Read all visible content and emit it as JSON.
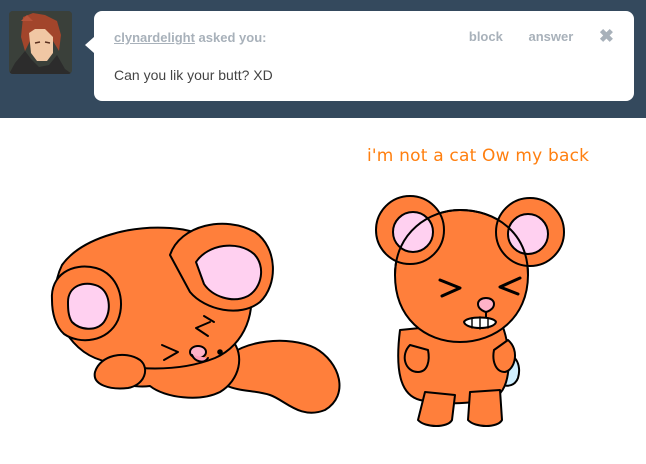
{
  "ask": {
    "asker_name": "clynardelight",
    "asked_text": "asked you:",
    "question": "Can you lik your butt? XD",
    "actions": {
      "block": "block",
      "answer": "answer",
      "close_glyph": "✖"
    }
  },
  "comic": {
    "caption": "i'm not a cat Ow my back",
    "colors": {
      "fur": "#ff7f3b",
      "ear_inner": "#ffd0f0",
      "outline": "#000000",
      "caption": "#ff7f0f",
      "header_bg": "#34495d"
    }
  }
}
